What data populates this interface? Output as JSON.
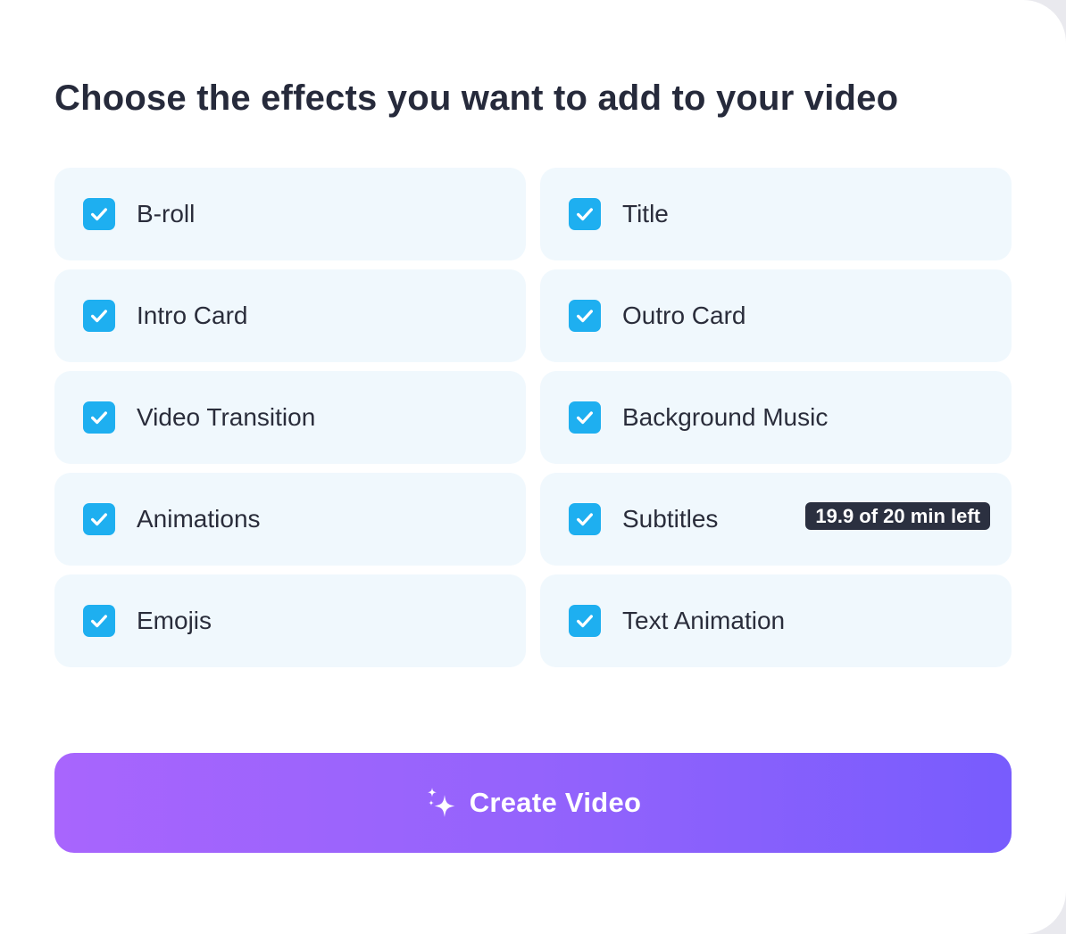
{
  "heading": "Choose the effects you want to add to your video",
  "options": [
    {
      "label": "B-roll",
      "checked": true
    },
    {
      "label": "Title",
      "checked": true
    },
    {
      "label": "Intro Card",
      "checked": true
    },
    {
      "label": "Outro Card",
      "checked": true
    },
    {
      "label": "Video Transition",
      "checked": true
    },
    {
      "label": "Background Music",
      "checked": true
    },
    {
      "label": "Animations",
      "checked": true
    },
    {
      "label": "Subtitles",
      "checked": true,
      "badge": "19.9 of 20 min left"
    },
    {
      "label": "Emojis",
      "checked": true
    },
    {
      "label": "Text Animation",
      "checked": true
    }
  ],
  "cta": {
    "label": "Create Video",
    "icon": "sparkles-icon"
  },
  "colors": {
    "checkbox": "#1eaff0",
    "card_bg": "#f0f8fd",
    "badge_bg": "#2b3040",
    "gradient_start": "#a865fd",
    "gradient_end": "#785cfd",
    "text": "#262a3b"
  }
}
